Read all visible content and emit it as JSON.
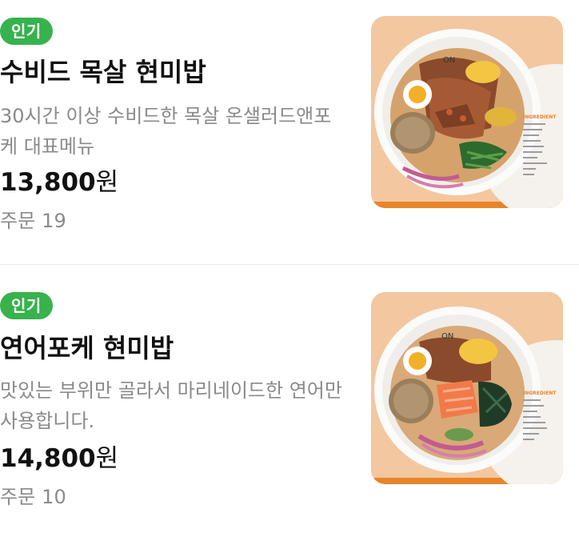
{
  "colors": {
    "badge_bg": "#37b24d",
    "thumb_bg": "#f3c79f",
    "thumb_accent": "#e8842a",
    "divider": "#e9e9e9",
    "muted_text": "#8a8a8a"
  },
  "menu": [
    {
      "badge": "인기",
      "title": "수비드 목살 현미밥",
      "description": "30시간 이상 수비드한 목살 온샐러드앤포케 대표메뉴",
      "price": "13,800",
      "price_unit": "원",
      "orders_label": "주문",
      "orders_count": "19",
      "image": {
        "alt": "수비드 목살 현미밥 photo",
        "brand": "ON",
        "tag": "INGREDIENT",
        "main_topping_color": "#8b4a2b"
      }
    },
    {
      "badge": "인기",
      "title": "연어포케 현미밥",
      "description": "맛있는 부위만 골라서 마리네이드한 연어만 사용합니다.",
      "price": "14,800",
      "price_unit": "원",
      "orders_label": "주문",
      "orders_count": "10",
      "image": {
        "alt": "연어포케 현미밥 photo",
        "brand": "ON",
        "tag": "INGREDIENT",
        "main_topping_color": "#f27a4a"
      }
    }
  ]
}
